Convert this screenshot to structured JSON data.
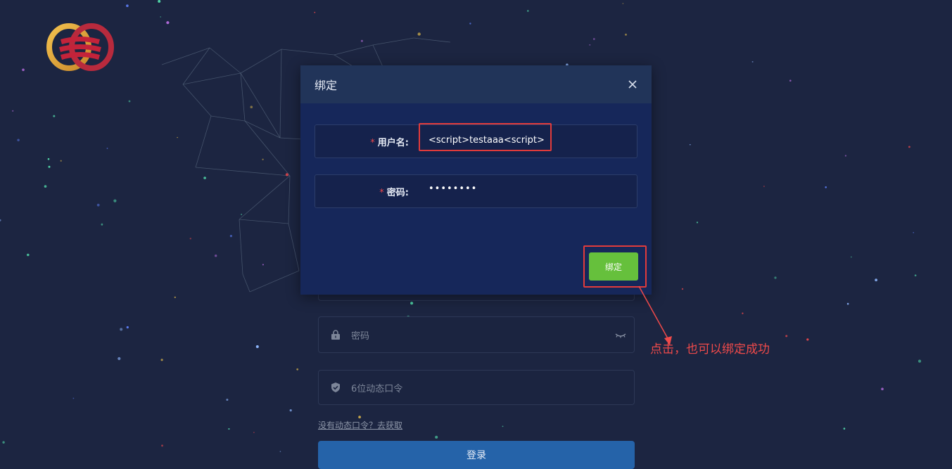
{
  "modal": {
    "title": "绑定",
    "username_label": "用户名:",
    "username_value": "<script>testaaa<script>",
    "password_label": "密码:",
    "password_value": "••••••••",
    "required_mark": "*",
    "bind_button": "绑定"
  },
  "login": {
    "password_placeholder": "密码",
    "otp_placeholder": "6位动态口令",
    "get_otp_link": "没有动态口令？去获取",
    "login_button": "登录"
  },
  "annotation": {
    "text": "点击，也可以绑定成功"
  },
  "icons": {
    "close": "close-icon",
    "lock": "lock-icon",
    "eye": "eye-closed-icon",
    "shield": "shield-check-icon",
    "logo": "brand-logo"
  },
  "colors": {
    "background": "#1c2541",
    "modal": "#16275a",
    "modal_header": "#213459",
    "primary_green": "#66c03c",
    "highlight_red": "#e23b3b",
    "login_blue": "#2563a9"
  }
}
